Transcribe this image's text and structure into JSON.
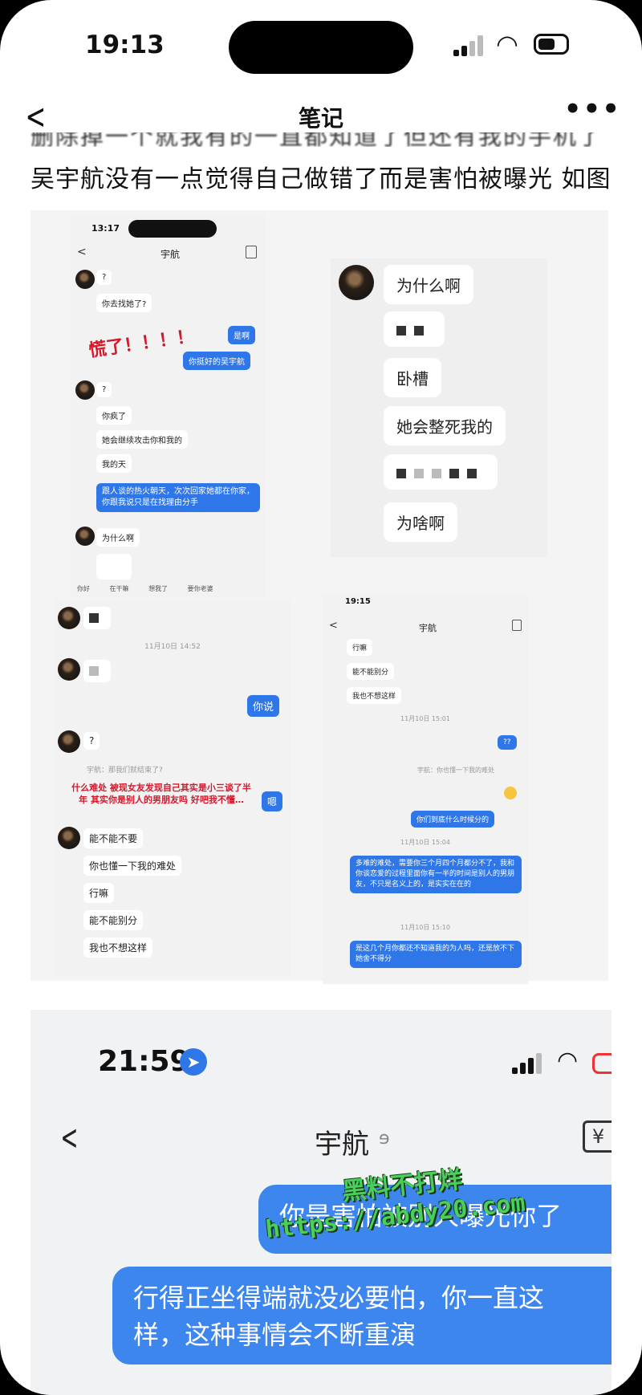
{
  "status": {
    "time": "19:13"
  },
  "nav": {
    "back": "<",
    "title": "笔记",
    "more": "•••"
  },
  "note": {
    "cut_line": "删除掉一个就我有的一直都知道了但还有我的手机了了",
    "text_line": "吴宇航没有一点觉得自己做错了而是害怕被曝光 如图"
  },
  "shot1": {
    "time": "13:17",
    "title": "宇航",
    "msgs": [
      "?",
      "你去找她了?",
      "是啊",
      "你挺好的吴宇航",
      "?",
      "你疯了",
      "她会继续攻击你和我的",
      "我的天",
      "跟人谈的热火朝天，次次回家她都在你家，你跟我说只是在找理由分手",
      "为什么啊"
    ],
    "annotation": "慌了！！！！",
    "reactions": [
      "你好",
      "在干嘛",
      "想我了",
      "要你老婆"
    ]
  },
  "shot2": {
    "msgs": [
      "为什么啊",
      "卧槽",
      "她会整死我的",
      "为啥啊"
    ]
  },
  "shot3": {
    "timestamp": "11月10日 14:52",
    "msgs": [
      "你说",
      "?",
      "嗯",
      "能不能不要",
      "你也懂一下我的难处",
      "行嘛",
      "能不能别分",
      "我也不想这样"
    ],
    "recall": "宇航：那我们就结束了?",
    "annotation": "什么难处 被现女友发现自己其实是小三谈了半年 其实你是别人的男朋友吗 好吧我不懂…"
  },
  "shot4": {
    "time": "19:15",
    "title": "宇航",
    "msgs": [
      "行嘛",
      "能不能别分",
      "我也不想这样",
      "??",
      "你们到底什么时候分的",
      "多难的难处，需要你三个月四个月都分不了，我和你谈恋爱的过程里面你有一半的时间是别人的男朋友，不只是名义上的，是实实在在的",
      "是这几个月你都还不知道我的为人吗，还是放不下她舍不得分"
    ],
    "timestamps": [
      "11月10日 15:01",
      "11月10日 15:04",
      "11月10日 15:10"
    ],
    "recall": "宇航：你也懂一下我的难处"
  },
  "shot5": {
    "time": "21:59",
    "title": "宇航",
    "msg1": "你是害怕被别人曝光你了",
    "msg2": "行得正坐得端就没必要怕，你一直这样，这种事情会不断重演"
  },
  "watermark": {
    "line1": "黑料不打烊",
    "line2": "https://abdy20.com"
  },
  "colors": {
    "bubble_blue": "#2f77e8",
    "annotation_red": "#d4192c",
    "watermark_green": "#4ad05a"
  }
}
